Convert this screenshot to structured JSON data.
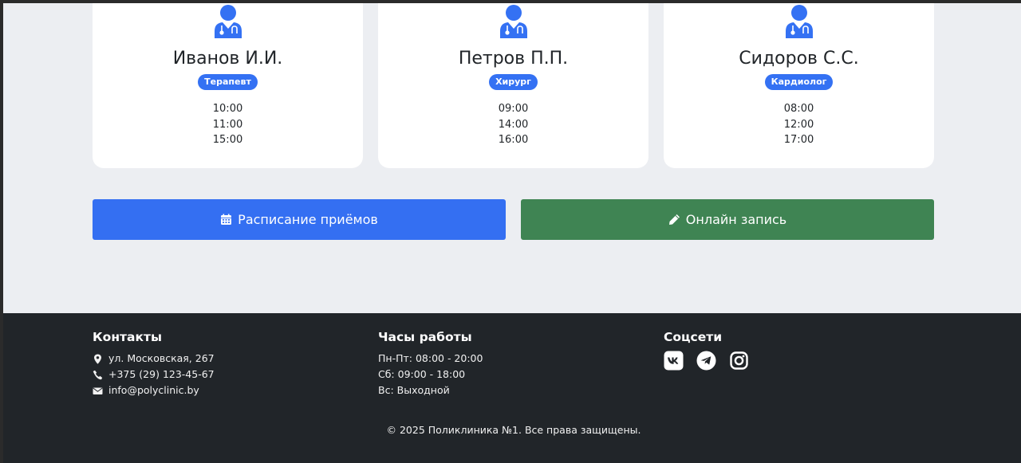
{
  "doctors": [
    {
      "name": "Иванов И.И.",
      "specialty": "Терапевт",
      "times": [
        "10:00",
        "11:00",
        "15:00"
      ]
    },
    {
      "name": "Петров П.П.",
      "specialty": "Хирург",
      "times": [
        "09:00",
        "14:00",
        "16:00"
      ]
    },
    {
      "name": "Сидоров С.С.",
      "specialty": "Кардиолог",
      "times": [
        "08:00",
        "12:00",
        "17:00"
      ]
    }
  ],
  "actions": {
    "schedule_label": "Расписание приёмов",
    "booking_label": "Онлайн запись"
  },
  "footer": {
    "contacts": {
      "title": "Контакты",
      "address": "ул. Московская, 267",
      "phone": "+375 (29) 123-45-67",
      "email": "info@polyclinic.by"
    },
    "hours": {
      "title": "Часы работы",
      "weekdays": "Пн-Пт: 08:00 - 20:00",
      "saturday": "Сб: 09:00 - 18:00",
      "sunday": "Вс: Выходной"
    },
    "social": {
      "title": "Соцсети",
      "icons": [
        "vk-icon",
        "telegram-icon",
        "instagram-icon"
      ]
    },
    "copyright": "© 2025 Поликлиника №1. Все права защищены."
  },
  "colors": {
    "accent": "#3471f3",
    "success": "#3f8453",
    "footer_bg": "#212529",
    "page_bg": "#eceef2"
  }
}
